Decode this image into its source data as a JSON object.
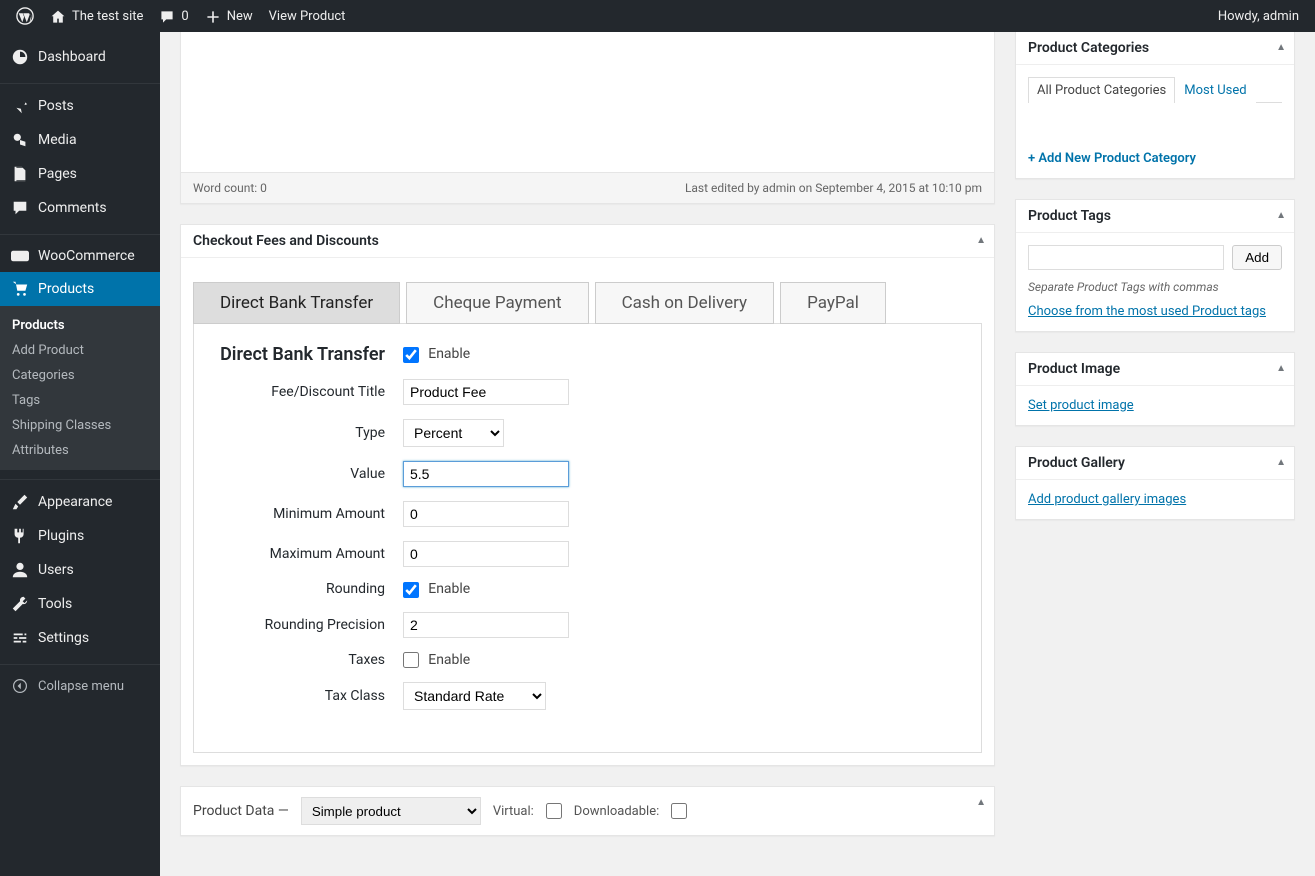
{
  "adminbar": {
    "site_name": "The test site",
    "comments_count": "0",
    "new_label": "New",
    "view_product": "View Product",
    "howdy": "Howdy, admin"
  },
  "sidebar": {
    "dashboard": "Dashboard",
    "posts": "Posts",
    "media": "Media",
    "pages": "Pages",
    "comments": "Comments",
    "woocommerce": "WooCommerce",
    "products": "Products",
    "appearance": "Appearance",
    "plugins": "Plugins",
    "users": "Users",
    "tools": "Tools",
    "settings": "Settings",
    "collapse": "Collapse menu",
    "submenu": {
      "products": "Products",
      "add_product": "Add Product",
      "categories": "Categories",
      "tags": "Tags",
      "shipping": "Shipping Classes",
      "attributes": "Attributes"
    }
  },
  "editor": {
    "word_count_label": "Word count: 0",
    "last_edited": "Last edited by admin on September 4, 2015 at 10:10 pm"
  },
  "fees_box": {
    "title": "Checkout Fees and Discounts",
    "tabs": [
      "Direct Bank Transfer",
      "Cheque Payment",
      "Cash on Delivery",
      "PayPal"
    ],
    "active_tab_title": "Direct Bank Transfer",
    "enable_label": "Enable",
    "fields": {
      "title_label": "Fee/Discount Title",
      "title_value": "Product Fee",
      "type_label": "Type",
      "type_value": "Percent",
      "value_label": "Value",
      "value_value": "5.5",
      "min_label": "Minimum Amount",
      "min_value": "0",
      "max_label": "Maximum Amount",
      "max_value": "0",
      "rounding_label": "Rounding",
      "rounding_enable": "Enable",
      "precision_label": "Rounding Precision",
      "precision_value": "2",
      "taxes_label": "Taxes",
      "taxes_enable": "Enable",
      "taxclass_label": "Tax Class",
      "taxclass_value": "Standard Rate"
    }
  },
  "product_data": {
    "heading": "Product Data —",
    "type": "Simple product",
    "virtual": "Virtual:",
    "downloadable": "Downloadable:"
  },
  "right": {
    "categories": {
      "title": "Product Categories",
      "tab_all": "All Product Categories",
      "tab_most": "Most Used",
      "add_link": "+ Add New Product Category"
    },
    "tags": {
      "title": "Product Tags",
      "add_btn": "Add",
      "note": "Separate Product Tags with commas",
      "choose": "Choose from the most used Product tags"
    },
    "image": {
      "title": "Product Image",
      "set": "Set product image"
    },
    "gallery": {
      "title": "Product Gallery",
      "add": "Add product gallery images"
    }
  }
}
